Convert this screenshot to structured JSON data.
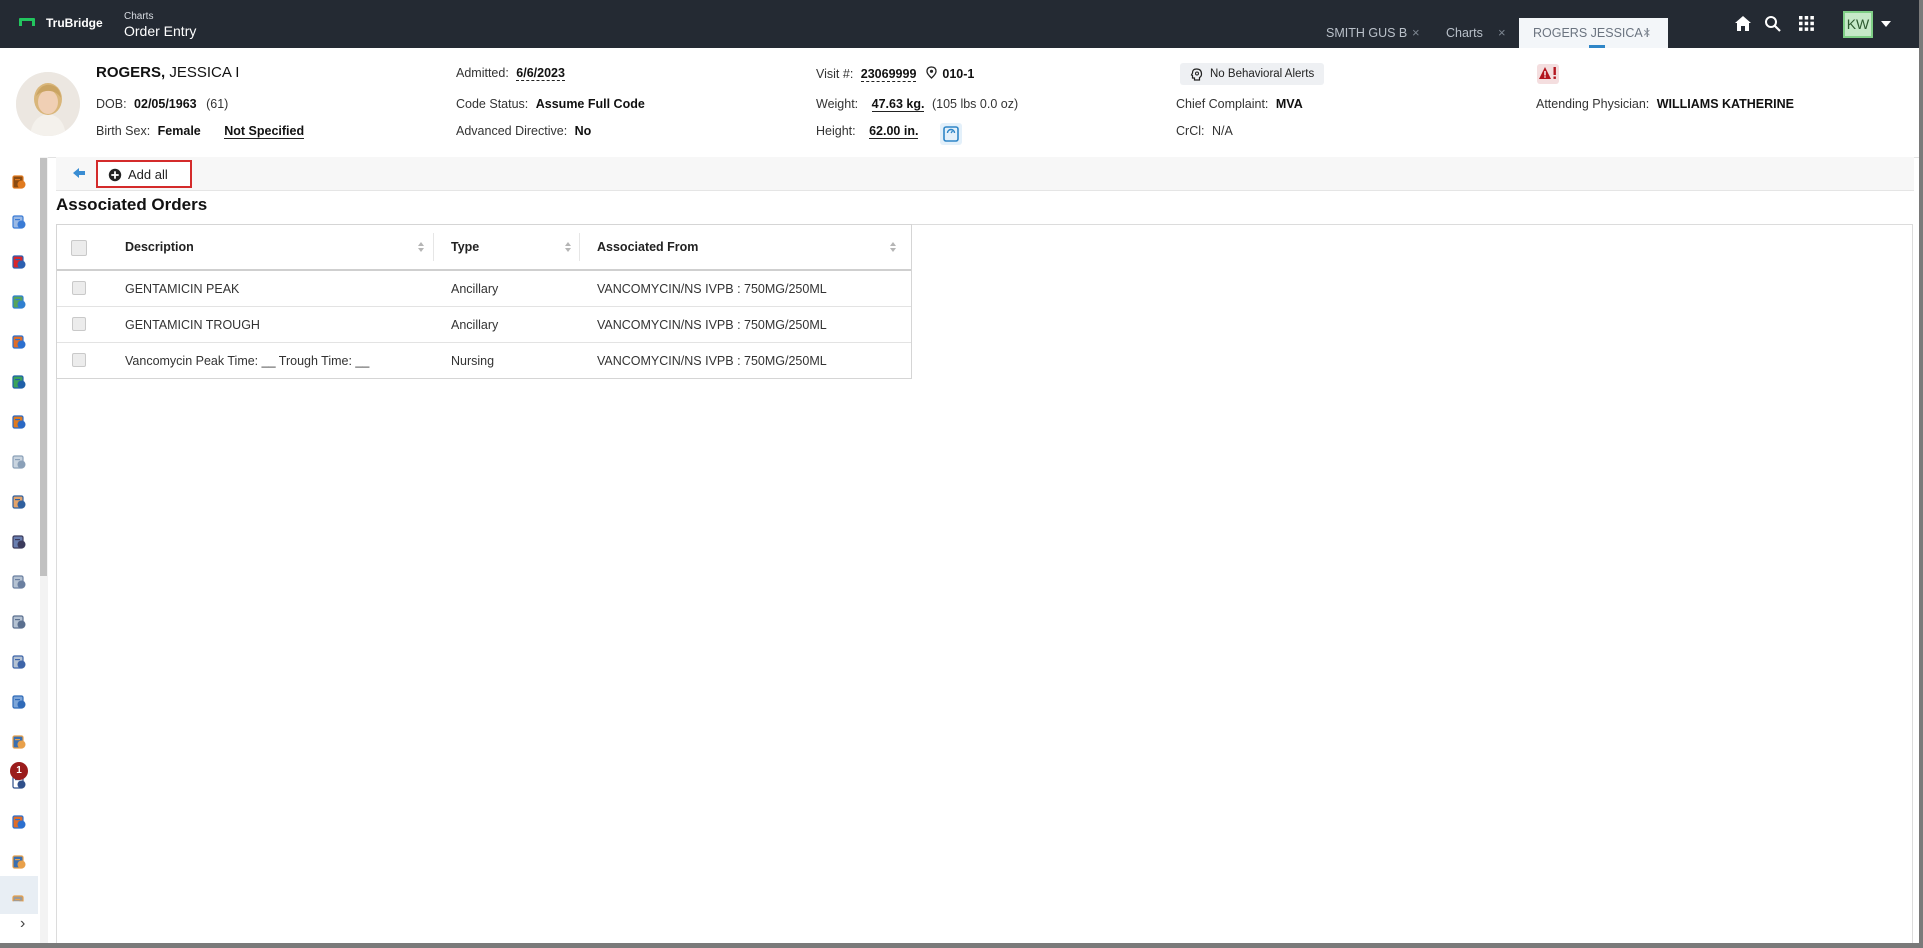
{
  "topbar": {
    "brand": "TruBridge",
    "crumb_sub": "Charts",
    "crumb_main": "Order Entry",
    "tabs": [
      {
        "label": "SMITH GUS B"
      },
      {
        "label": "Charts"
      },
      {
        "label": "ROGERS JESSICA I"
      }
    ],
    "user_initials": "KW",
    "accent_color": "#2f86c7",
    "bar_color": "#242a33"
  },
  "patient": {
    "last_name": "ROGERS,",
    "first_name": "JESSICA I",
    "dob_label": "DOB:",
    "dob": "02/05/1963",
    "age": "(61)",
    "birth_sex_label": "Birth Sex:",
    "birth_sex": "Female",
    "gender_identity": "Not Specified",
    "admitted_label": "Admitted:",
    "admitted": "6/6/2023",
    "code_status_label": "Code Status:",
    "code_status": "Assume Full Code",
    "advanced_directive_label": "Advanced Directive:",
    "advanced_directive": "No",
    "visit_label": "Visit #:",
    "visit": "23069999",
    "location": "010-1",
    "weight_label": "Weight:",
    "weight": "47.63 kg.",
    "weight_alt": "(105 lbs 0.0 oz)",
    "height_label": "Height:",
    "height": "62.00 in.",
    "behavioral_alerts": "No Behavioral Alerts",
    "chief_complaint_label": "Chief Complaint:",
    "chief_complaint": "MVA",
    "crcl_label": "CrCl:",
    "crcl": "N/A",
    "attending_label": "Attending Physician:",
    "attending": "WILLIAMS KATHERINE"
  },
  "sidebar": {
    "notification_count": "1",
    "icons": [
      "allergy-icon",
      "lab-flask-icon",
      "clipboard-check-icon",
      "vitals-monitor-icon",
      "medication-globe-icon",
      "assessment-icon",
      "orders-icon",
      "syringe-icon",
      "nurse-icon",
      "imaging-icon",
      "document-search-icon",
      "document-edit-icon",
      "document-list-icon",
      "attachment-icon",
      "order-entry-icon",
      "help-doc-icon",
      "care-plan-icon",
      "physician-icon",
      "more-icon"
    ]
  },
  "toolbar": {
    "add_all_label": "Add all"
  },
  "section": {
    "title": "Associated Orders"
  },
  "grid": {
    "columns": [
      "Description",
      "Type",
      "Associated From"
    ],
    "rows": [
      {
        "description": "GENTAMICIN PEAK",
        "type": "Ancillary",
        "from": "VANCOMYCIN/NS IVPB : 750MG/250ML"
      },
      {
        "description": "GENTAMICIN TROUGH",
        "type": "Ancillary",
        "from": "VANCOMYCIN/NS IVPB : 750MG/250ML"
      },
      {
        "description": "Vancomycin Peak Time: __ Trough Time: __",
        "type": "Nursing",
        "from": "VANCOMYCIN/NS IVPB : 750MG/250ML"
      }
    ]
  }
}
